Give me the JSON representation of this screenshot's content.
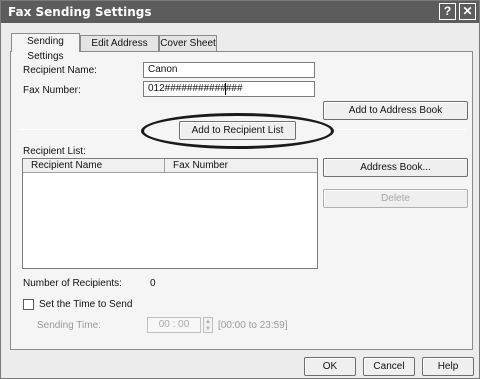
{
  "window": {
    "title": "Fax Sending Settings",
    "help_glyph": "?",
    "close_glyph": "✕"
  },
  "tabs": [
    {
      "label": "Sending Settings",
      "active": true
    },
    {
      "label": "Edit Address Book",
      "active": false
    },
    {
      "label": "Cover Sheet",
      "active": false
    }
  ],
  "form": {
    "recipient_name_label": "Recipient Name:",
    "recipient_name_value": "Canon",
    "fax_number_label": "Fax Number:",
    "fax_number_value": "012##############"
  },
  "buttons": {
    "add_to_address_book": "Add to Address Book",
    "add_to_recipient_list": "Add to Recipient List",
    "address_book": "Address Book...",
    "delete": "Delete",
    "ok": "OK",
    "cancel": "Cancel",
    "help": "Help"
  },
  "recipient_list": {
    "label": "Recipient List:",
    "columns": [
      "Recipient Name",
      "Fax Number"
    ],
    "rows": []
  },
  "recipients": {
    "label": "Number of Recipients:",
    "count": "0"
  },
  "schedule": {
    "checkbox_label": "Set the Time to Send",
    "checked": false,
    "time_label": "Sending Time:",
    "time_value": "00 : 00",
    "range_hint": "[00:00 to 23:59]"
  },
  "icons": {
    "spin_up": "spin-up-icon",
    "spin_down": "spin-down-icon"
  }
}
